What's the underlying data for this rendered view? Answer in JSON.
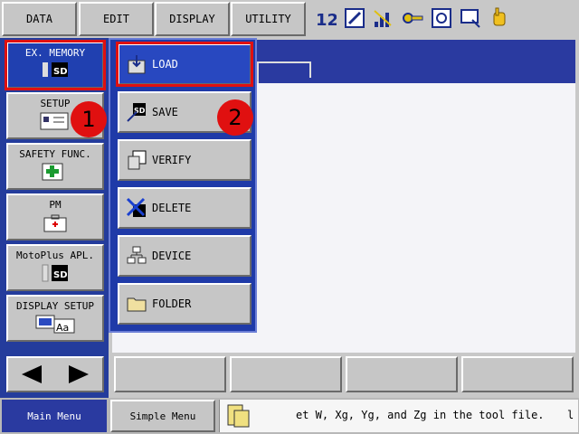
{
  "top_menu": {
    "data": "DATA",
    "edit": "EDIT",
    "display": "DISPLAY",
    "utility": "UTILITY"
  },
  "status_icons": [
    "12",
    "edit-box",
    "signal",
    "key",
    "gear",
    "monitor",
    "hand"
  ],
  "side_menu": {
    "items": [
      {
        "label": "EX. MEMORY"
      },
      {
        "label": "SETUP"
      },
      {
        "label": "SAFETY FUNC."
      },
      {
        "label": "PM"
      },
      {
        "label": "MotoPlus APL."
      },
      {
        "label": "DISPLAY SETUP"
      }
    ]
  },
  "sub_menu": {
    "items": [
      {
        "label": "LOAD"
      },
      {
        "label": "SAVE"
      },
      {
        "label": "VERIFY"
      },
      {
        "label": "DELETE"
      },
      {
        "label": "DEVICE"
      },
      {
        "label": "FOLDER"
      }
    ]
  },
  "markers": {
    "one": "1",
    "two": "2"
  },
  "footer": {
    "main_menu": "Main Menu",
    "simple_menu": "Simple Menu",
    "message": "et W, Xg, Yg, and Zg in the tool file.",
    "trailing": "l"
  },
  "colors": {
    "panel_blue": "#243c9c",
    "highlight_red": "#e01010",
    "button_gray": "#c6c6c6"
  }
}
